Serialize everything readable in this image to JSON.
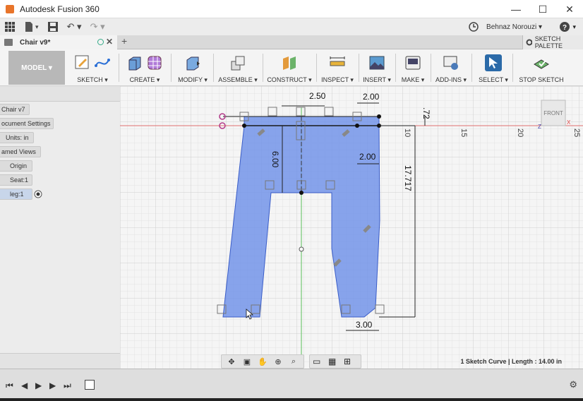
{
  "window": {
    "title": "Autodesk Fusion 360",
    "min": "—",
    "max": "☐",
    "close": "✕"
  },
  "qat": {
    "grid_icon": "grid-icon",
    "file_label": "▾",
    "save_label": "💾",
    "undo": "↶ ▾",
    "redo": "↷ ▾",
    "user": "Behnaz Norouzi ▾",
    "help": "? ▾",
    "clock": "🕘"
  },
  "tab": {
    "doc_title": "Chair v9*",
    "close": "✕",
    "new": "+",
    "palette": "SKETCH PALETTE"
  },
  "ribbon": {
    "workspace": "MODEL ▾",
    "groups": [
      {
        "label": "SKETCH ▾"
      },
      {
        "label": "CREATE ▾"
      },
      {
        "label": "MODIFY ▾"
      },
      {
        "label": "ASSEMBLE ▾"
      },
      {
        "label": "CONSTRUCT ▾"
      },
      {
        "label": "INSPECT ▾"
      },
      {
        "label": "INSERT ▾"
      },
      {
        "label": "MAKE ▾"
      },
      {
        "label": "ADD-INS ▾"
      },
      {
        "label": "SELECT ▾"
      },
      {
        "label": "STOP SKETCH"
      }
    ]
  },
  "browser": {
    "items": [
      "Chair v7",
      "ocument Settings",
      "Units: in",
      "amed Views",
      "Origin",
      "Seat:1",
      "leg:1"
    ]
  },
  "canvas": {
    "dimensions": [
      "2.50",
      "2.00",
      "6.00",
      "2.00",
      "17.717",
      "3.00",
      ".72"
    ],
    "ruler": [
      "10",
      "15",
      "20",
      "25"
    ],
    "viewcube": "FRONT",
    "axis_labels": [
      "X",
      "Z"
    ]
  },
  "status": {
    "text": "1 Sketch Curve | Length : 14.00 in"
  },
  "colors": {
    "sketch_fill": "#6b8fe8",
    "accent": "#e8742a",
    "ribbon_bg": "#f4f4f4"
  }
}
